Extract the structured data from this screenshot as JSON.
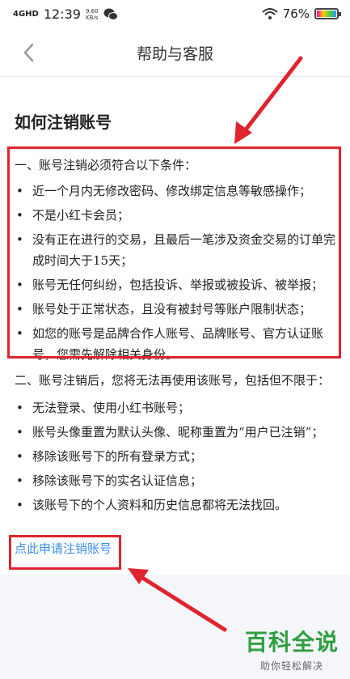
{
  "status_bar": {
    "signal": "4GHD",
    "time": "12:39",
    "speed_value": "9.60",
    "speed_unit": "KB/s",
    "battery": "76%"
  },
  "nav": {
    "title": "帮助与客服"
  },
  "article": {
    "title": "如何注销账号",
    "section1": {
      "heading": "一、账号注销必须符合以下条件：",
      "items": [
        "近一个月内无修改密码、修改绑定信息等敏感操作；",
        "不是小红卡会员；",
        "没有正在进行的交易，且最后一笔涉及资金交易的订单完成时间大于15天；",
        "账号无任何纠纷，包括投诉、举报或被投诉、被举报；",
        "账号处于正常状态，且没有被封号等账户限制状态；",
        "如您的账号是品牌合作人账号、品牌账号、官方认证账号，您需先解除相关身份。"
      ]
    },
    "section2": {
      "heading": "二、账号注销后，您将无法再使用该账号，包括但不限于：",
      "items": [
        "无法登录、使用小红书账号；",
        "账号头像重置为默认头像、昵称重置为“用户已注销”；",
        "移除该账号下的所有登录方式；",
        "移除该账号下的实名认证信息；",
        "该账号下的个人资料和历史信息都将无法找回。"
      ]
    },
    "link": "点此申请注销账号"
  },
  "watermark": {
    "main": "百科全说",
    "sub": "助你轻松解决"
  },
  "colors": {
    "accent_red": "#e0242f",
    "link_blue": "#3a8ee6",
    "watermark_green": "#2f9e3f"
  }
}
